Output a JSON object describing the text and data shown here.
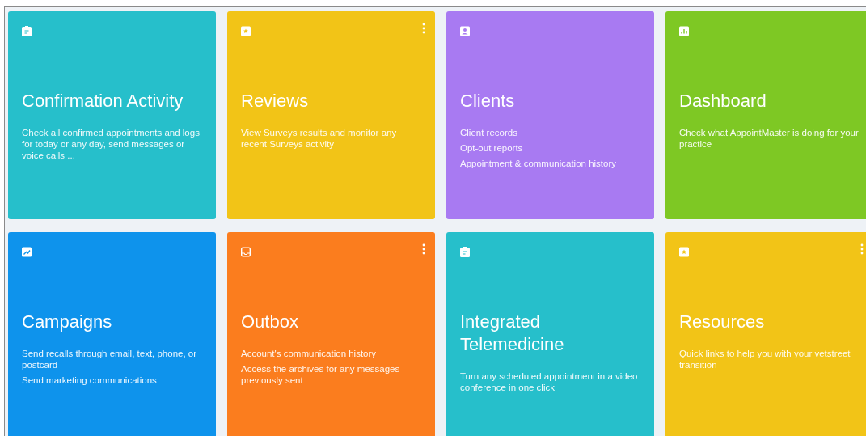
{
  "tiles": [
    {
      "title": "Confirmation Activity",
      "color": "#26bfcb",
      "menu": false,
      "lines": [
        "Check all confirmed appointments and logs for today or any day, send messages or voice calls ..."
      ]
    },
    {
      "title": "Reviews",
      "color": "#f2c417",
      "menu": true,
      "lines": [
        "View Surveys results and monitor any recent Surveys activity"
      ]
    },
    {
      "title": "Clients",
      "color": "#a87af2",
      "menu": false,
      "lines": [
        "Client records",
        "Opt-out reports",
        "Appointment & communication history"
      ]
    },
    {
      "title": "Dashboard",
      "color": "#7ec824",
      "menu": false,
      "lines": [
        "Check what AppointMaster is doing for your practice"
      ]
    },
    {
      "title": "Campaigns",
      "color": "#0e93ec",
      "menu": false,
      "lines": [
        "Send recalls through email, text, phone, or postcard",
        "Send marketing communications"
      ]
    },
    {
      "title": "Outbox",
      "color": "#fb7d1e",
      "menu": true,
      "lines": [
        "Account's communication history",
        "Access the archives for any messages previously sent"
      ]
    },
    {
      "title": "Integrated Telemedicine",
      "color": "#26bfcb",
      "menu": false,
      "lines": [
        "Turn any scheduled appointment in a video conference in one click"
      ]
    },
    {
      "title": "Resources",
      "color": "#f2c417",
      "menu": true,
      "lines": [
        "Quick links to help you with your vetstreet transition"
      ]
    }
  ]
}
